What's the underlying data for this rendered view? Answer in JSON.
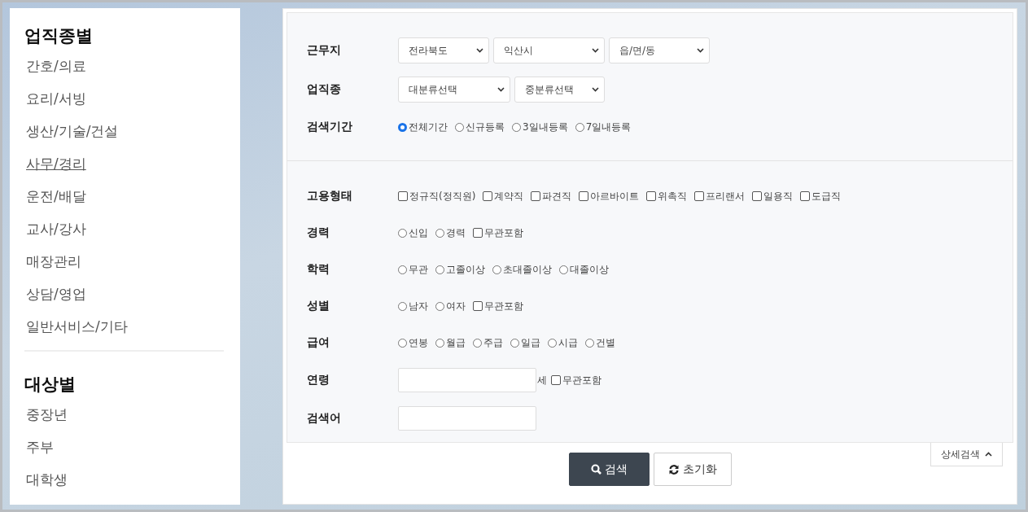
{
  "sidebar": {
    "sections": [
      {
        "title": "업직종별",
        "items": [
          {
            "label": "간호/의료",
            "selected": false
          },
          {
            "label": "요리/서빙",
            "selected": false
          },
          {
            "label": "생산/기술/건설",
            "selected": false
          },
          {
            "label": "사무/경리",
            "selected": true
          },
          {
            "label": "운전/배달",
            "selected": false
          },
          {
            "label": "교사/강사",
            "selected": false
          },
          {
            "label": "매장관리",
            "selected": false
          },
          {
            "label": "상담/영업",
            "selected": false
          },
          {
            "label": "일반서비스/기타",
            "selected": false
          }
        ]
      },
      {
        "title": "대상별",
        "items": [
          {
            "label": "중장년",
            "selected": false
          },
          {
            "label": "주부",
            "selected": false
          },
          {
            "label": "대학생",
            "selected": false
          }
        ]
      }
    ]
  },
  "search_form": {
    "basic_rows": [
      {
        "label": "근무지",
        "kind": "selects",
        "selects": [
          {
            "value": "전라북도"
          },
          {
            "value": "익산시"
          },
          {
            "value": "읍/면/동"
          }
        ]
      },
      {
        "label": "업직종",
        "kind": "selects",
        "selects": [
          {
            "value": "대분류선택"
          },
          {
            "value": "중분류선택"
          }
        ]
      },
      {
        "label": "검색기간",
        "kind": "options",
        "options": [
          {
            "kind": "radio",
            "label": "전체기간",
            "selected": true
          },
          {
            "kind": "radio",
            "label": "신규등록",
            "selected": false
          },
          {
            "kind": "radio",
            "label": "3일내등록",
            "selected": false
          },
          {
            "kind": "radio",
            "label": "7일내등록",
            "selected": false
          }
        ]
      }
    ],
    "detail_rows": [
      {
        "label": "고용형태",
        "kind": "options",
        "options": [
          {
            "kind": "checkbox",
            "label": "정규직(정직원)",
            "checked": false
          },
          {
            "kind": "checkbox",
            "label": "계약직",
            "checked": false
          },
          {
            "kind": "checkbox",
            "label": "파견직",
            "checked": false
          },
          {
            "kind": "checkbox",
            "label": "아르바이트",
            "checked": false
          },
          {
            "kind": "checkbox",
            "label": "위촉직",
            "checked": false
          },
          {
            "kind": "checkbox",
            "label": "프리랜서",
            "checked": false
          },
          {
            "kind": "checkbox",
            "label": "일용직",
            "checked": false
          },
          {
            "kind": "checkbox",
            "label": "도급직",
            "checked": false
          }
        ]
      },
      {
        "label": "경력",
        "kind": "options",
        "options": [
          {
            "kind": "radio",
            "label": "신입",
            "selected": false
          },
          {
            "kind": "radio",
            "label": "경력",
            "selected": false
          },
          {
            "kind": "checkbox",
            "label": "무관포함",
            "checked": false
          }
        ]
      },
      {
        "label": "학력",
        "kind": "options",
        "options": [
          {
            "kind": "radio",
            "label": "무관",
            "selected": false
          },
          {
            "kind": "radio",
            "label": "고졸이상",
            "selected": false
          },
          {
            "kind": "radio",
            "label": "초대졸이상",
            "selected": false
          },
          {
            "kind": "radio",
            "label": "대졸이상",
            "selected": false
          }
        ]
      },
      {
        "label": "성별",
        "kind": "options",
        "options": [
          {
            "kind": "radio",
            "label": "남자",
            "selected": false
          },
          {
            "kind": "radio",
            "label": "여자",
            "selected": false
          },
          {
            "kind": "checkbox",
            "label": "무관포함",
            "checked": false
          }
        ]
      },
      {
        "label": "급여",
        "kind": "options",
        "options": [
          {
            "kind": "radio",
            "label": "연봉",
            "selected": false
          },
          {
            "kind": "radio",
            "label": "월급",
            "selected": false
          },
          {
            "kind": "radio",
            "label": "주급",
            "selected": false
          },
          {
            "kind": "radio",
            "label": "일급",
            "selected": false
          },
          {
            "kind": "radio",
            "label": "시급",
            "selected": false
          },
          {
            "kind": "radio",
            "label": "건별",
            "selected": false
          }
        ]
      },
      {
        "label": "연령",
        "kind": "input",
        "suffix": "세",
        "options": [
          {
            "kind": "checkbox",
            "label": "무관포함",
            "checked": false
          }
        ]
      },
      {
        "label": "검색어",
        "kind": "input"
      }
    ],
    "buttons": [
      {
        "kind": "search",
        "label": "검색"
      },
      {
        "kind": "reset",
        "label": "초기화"
      }
    ],
    "detail_toggle": {
      "label": "상세검색",
      "expanded": true
    }
  }
}
